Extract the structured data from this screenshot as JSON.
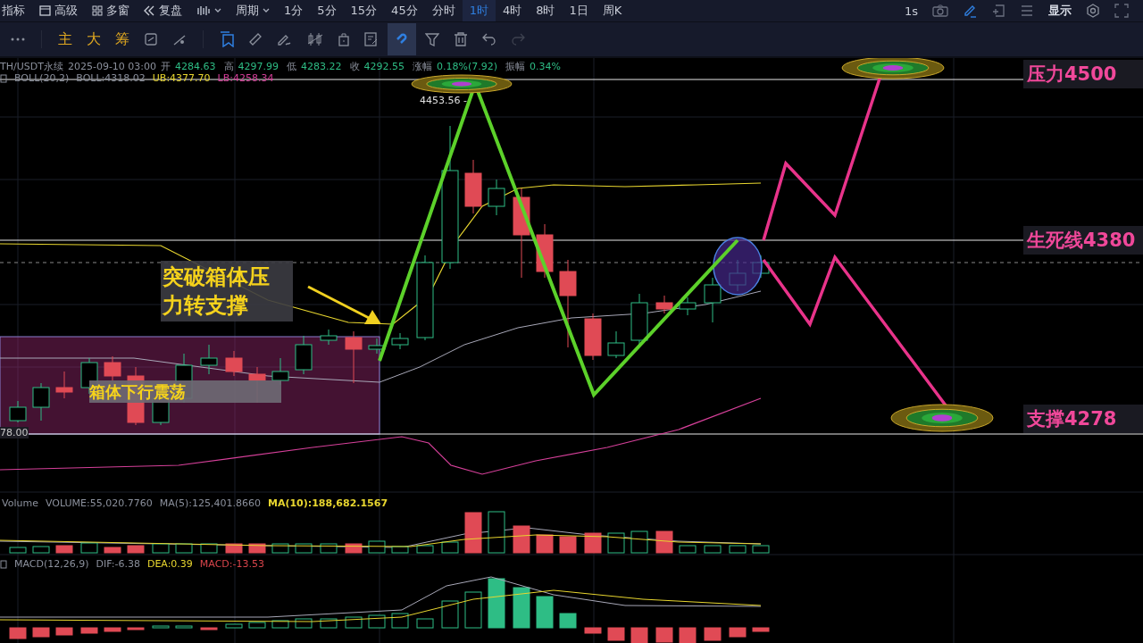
{
  "top_toolbar": {
    "items": [
      {
        "kind": "label",
        "label": "指标",
        "selected": false
      },
      {
        "kind": "icon-label",
        "label": "高级",
        "selected": false
      },
      {
        "kind": "icon-label",
        "label": "多窗",
        "selected": false
      },
      {
        "kind": "icon-label",
        "label": "复盘",
        "selected": false
      },
      {
        "kind": "chart-type",
        "selected": false
      },
      {
        "kind": "dropdown",
        "label": "周期",
        "selected": false
      },
      {
        "kind": "period",
        "label": "1分",
        "selected": false
      },
      {
        "kind": "period",
        "label": "5分",
        "selected": false
      },
      {
        "kind": "period",
        "label": "15分",
        "selected": false
      },
      {
        "kind": "period",
        "label": "45分",
        "selected": false
      },
      {
        "kind": "period",
        "label": "分时",
        "selected": false
      },
      {
        "kind": "period",
        "label": "1时",
        "selected": true
      },
      {
        "kind": "period",
        "label": "4时",
        "selected": false
      },
      {
        "kind": "period",
        "label": "8时",
        "selected": false
      },
      {
        "kind": "period",
        "label": "1日",
        "selected": false
      },
      {
        "kind": "period",
        "label": "周K",
        "selected": false
      }
    ],
    "refresh": "1s",
    "display": "显示"
  },
  "drawing_toolbar": {
    "text_buttons": [
      "主",
      "大",
      "筹"
    ],
    "magnet": {
      "on": true
    }
  },
  "chart": {
    "legend": {
      "symbol": "TH/USDT永续",
      "datetime": "2025-09-10 03:00",
      "fields": [
        {
          "label": "开",
          "value": "4284.63"
        },
        {
          "label": "高",
          "value": "4297.99"
        },
        {
          "label": "低",
          "value": "4283.22"
        },
        {
          "label": "收",
          "value": "4292.55"
        },
        {
          "label": "涨幅",
          "value": "0.18%(7.92)"
        },
        {
          "label": "振幅",
          "value": "0.34%"
        }
      ]
    },
    "boll": [
      {
        "text": "BOLL(20,2)",
        "color": "#8b909c"
      },
      {
        "text": "BOLL:4318.02",
        "color": "#8b909c"
      },
      {
        "text": "UB:4377.70",
        "color": "#e8d62f"
      },
      {
        "text": "LB:4258.34",
        "color": "#d6409a"
      }
    ],
    "high_label": "4453.56 -",
    "low_label": "78.00",
    "levels": [
      {
        "text": "压力4500"
      },
      {
        "text": "生死线4380"
      },
      {
        "text": "支撑4278"
      }
    ],
    "annotations": [
      {
        "kind": "callout",
        "text": "突破箱体压力转支撑"
      },
      {
        "kind": "box",
        "text": "箱体下行震荡"
      }
    ]
  },
  "volume": {
    "legend": [
      {
        "text": "Volume",
        "color": "#8b909c"
      },
      {
        "text": "VOLUME:55,020.7760",
        "color": "#8b909c"
      },
      {
        "text": "MA(5):125,401.8660",
        "color": "#8b909c"
      },
      {
        "text": "MA(10):188,682.1567",
        "color": "#e8d62f"
      }
    ]
  },
  "macd": {
    "legend": [
      {
        "text": "MACD(12,26,9)",
        "color": "#8b909c"
      },
      {
        "text": "DIF:-6.38",
        "color": "#8b909c"
      },
      {
        "text": "DEA:0.39",
        "color": "#e8d62f"
      },
      {
        "text": "MACD:-13.53",
        "color": "#d9444b"
      }
    ]
  }
}
